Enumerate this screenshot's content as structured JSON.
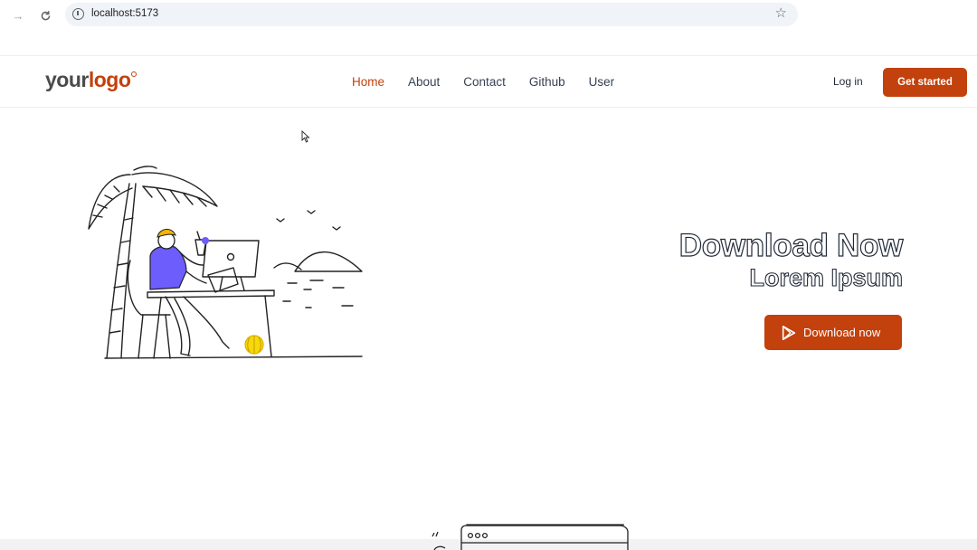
{
  "browser": {
    "url": "localhost:5173",
    "icons": [
      "forward-icon",
      "reload-icon",
      "info-icon",
      "star-icon"
    ]
  },
  "header": {
    "logo_your": "your",
    "logo_word": "logo",
    "nav": [
      {
        "label": "Home",
        "active": true
      },
      {
        "label": "About",
        "active": false
      },
      {
        "label": "Contact",
        "active": false
      },
      {
        "label": "Github",
        "active": false
      },
      {
        "label": "User",
        "active": false
      }
    ],
    "login_label": "Log in",
    "cta_label": "Get started"
  },
  "hero": {
    "title": "Download Now",
    "subtitle": "Lorem Ipsum",
    "button_label": "Download now",
    "button_icon": "google-play-icon"
  },
  "colors": {
    "accent": "#c2410c",
    "text": "#1f2937",
    "illustration_purple": "#6d5dfc",
    "illustration_yellow": "#f5d90a"
  }
}
